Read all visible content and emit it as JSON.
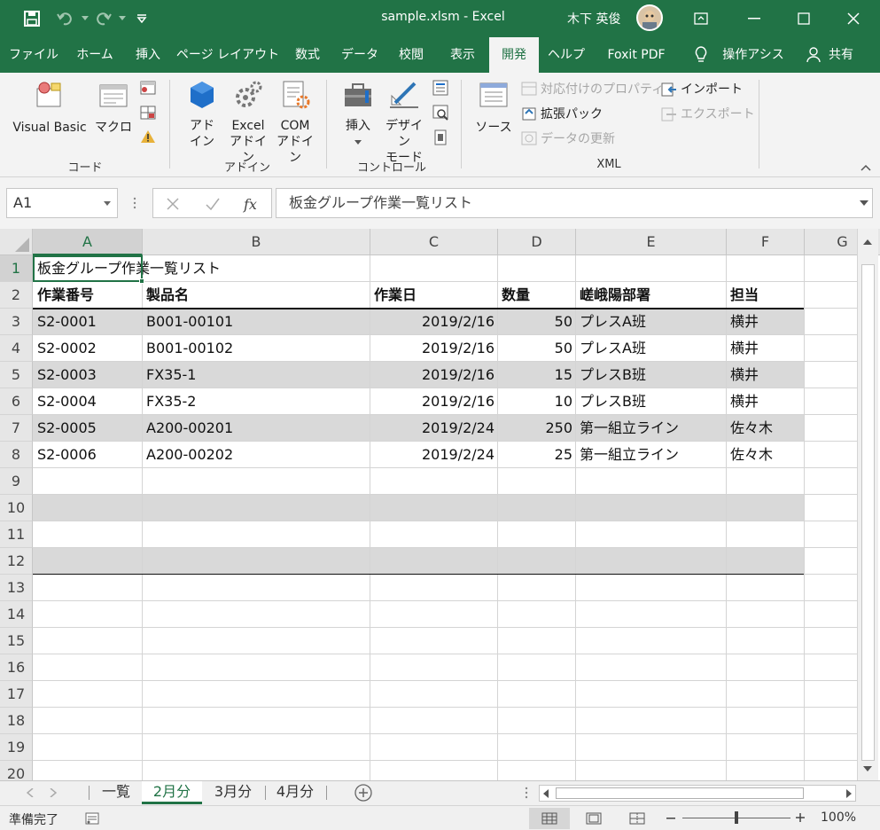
{
  "titlebar": {
    "title": "sample.xlsm  -  Excel",
    "user": "木下 英俊",
    "colors": {
      "brand": "#217346"
    }
  },
  "tabs": [
    "ファイル",
    "ホーム",
    "挿入",
    "ページ レイアウト",
    "数式",
    "データ",
    "校閲",
    "表示",
    "開発",
    "ヘルプ",
    "Foxit PDF",
    "操作アシス",
    "共有"
  ],
  "active_tab": "開発",
  "ribbon": {
    "code": {
      "visual_basic": "Visual Basic",
      "macro": "マクロ",
      "label": "コード"
    },
    "addins": {
      "addin_1": "アド",
      "addin_2": "イン",
      "excel_1": "Excel",
      "excel_2": "アドイン",
      "com_1": "COM",
      "com_2": "アドイン",
      "label": "アドイン"
    },
    "controls": {
      "insert": "挿入",
      "design_1": "デザイン",
      "design_2": "モード",
      "label": "コントロール"
    },
    "xml": {
      "source": "ソース",
      "map_props": "対応付けのプロパティ",
      "ext_pack": "拡張パック",
      "refresh": "データの更新",
      "import": "インポート",
      "export": "エクスポート",
      "label": "XML"
    }
  },
  "formula": {
    "name_box": "A1",
    "content": "板金グループ作業一覧リスト"
  },
  "columns": [
    "A",
    "B",
    "C",
    "D",
    "E",
    "F",
    "G"
  ],
  "rows": [
    "1",
    "2",
    "3",
    "4",
    "5",
    "6",
    "7",
    "8",
    "9",
    "10",
    "11",
    "12",
    "13",
    "14",
    "15",
    "16",
    "17",
    "18",
    "19",
    "20"
  ],
  "sheet": {
    "title": "板金グループ作業一覧リスト",
    "headers": [
      "作業番号",
      "製品名",
      "作業日",
      "数量",
      "嵯峨陽部署",
      "担当"
    ],
    "data": [
      [
        "S2-0001",
        "B001-00101",
        "2019/2/16",
        "50",
        "プレスA班",
        "横井"
      ],
      [
        "S2-0002",
        "B001-00102",
        "2019/2/16",
        "50",
        "プレスA班",
        "横井"
      ],
      [
        "S2-0003",
        "FX35-1",
        "2019/2/16",
        "15",
        "プレスB班",
        "横井"
      ],
      [
        "S2-0004",
        "FX35-2",
        "2019/2/16",
        "10",
        "プレスB班",
        "横井"
      ],
      [
        "S2-0005",
        "A200-00201",
        "2019/2/24",
        "250",
        "第一組立ライン",
        "佐々木"
      ],
      [
        "S2-0006",
        "A200-00202",
        "2019/2/24",
        "25",
        "第一組立ライン",
        "佐々木"
      ]
    ]
  },
  "sheet_tabs": [
    "一覧",
    "2月分",
    "3月分",
    "4月分"
  ],
  "active_sheet": "2月分",
  "status": {
    "ready": "準備完了",
    "zoom": "100%"
  }
}
